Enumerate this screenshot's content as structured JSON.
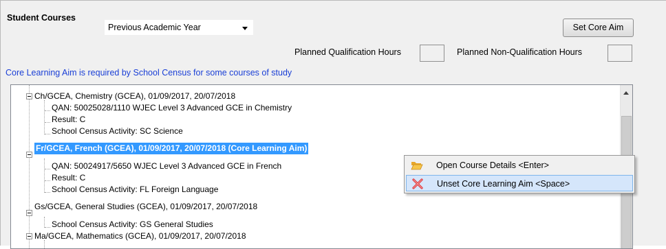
{
  "header": {
    "title": "Student Courses",
    "year_select": "Previous Academic Year",
    "set_core_aim_label": "Set Core Aim",
    "planned_qual_hours_label": "Planned Qualification Hours",
    "planned_nonqual_hours_label": "Planned Non-Qualification Hours",
    "note": "Core Learning Aim is required by School Census for some courses of study"
  },
  "tree": {
    "nodes": [
      {
        "label": "Ch/GCEA, Chemistry (GCEA), 01/09/2017, 20/07/2018"
      },
      {
        "label": "QAN: 50025028/1110 WJEC Level 3 Advanced GCE in Chemistry"
      },
      {
        "label": "Result: C"
      },
      {
        "label": "School Census Activity: SC Science"
      },
      {
        "label": "Fr/GCEA, French (GCEA), 01/09/2017, 20/07/2018 (Core Learning Aim)"
      },
      {
        "label": "QAN: 50024917/5650 WJEC Level 3 Advanced GCE in French"
      },
      {
        "label": "Result: C"
      },
      {
        "label": "School Census Activity: FL Foreign Language"
      },
      {
        "label": "Gs/GCEA, General Studies (GCEA), 01/09/2017, 20/07/2018"
      },
      {
        "label": "School Census Activity: GS General Studies"
      },
      {
        "label": "Ma/GCEA, Mathematics (GCEA), 01/09/2017, 20/07/2018"
      }
    ]
  },
  "context_menu": {
    "items": [
      {
        "label": "Open Course Details <Enter>",
        "icon": "folder-open-icon"
      },
      {
        "label": "Unset Core Learning Aim <Space>",
        "icon": "red-x-icon"
      }
    ]
  },
  "colors": {
    "selection": "#3399ff",
    "note_text": "#1a3fd6",
    "menu_hover": "#d5e6fb"
  }
}
